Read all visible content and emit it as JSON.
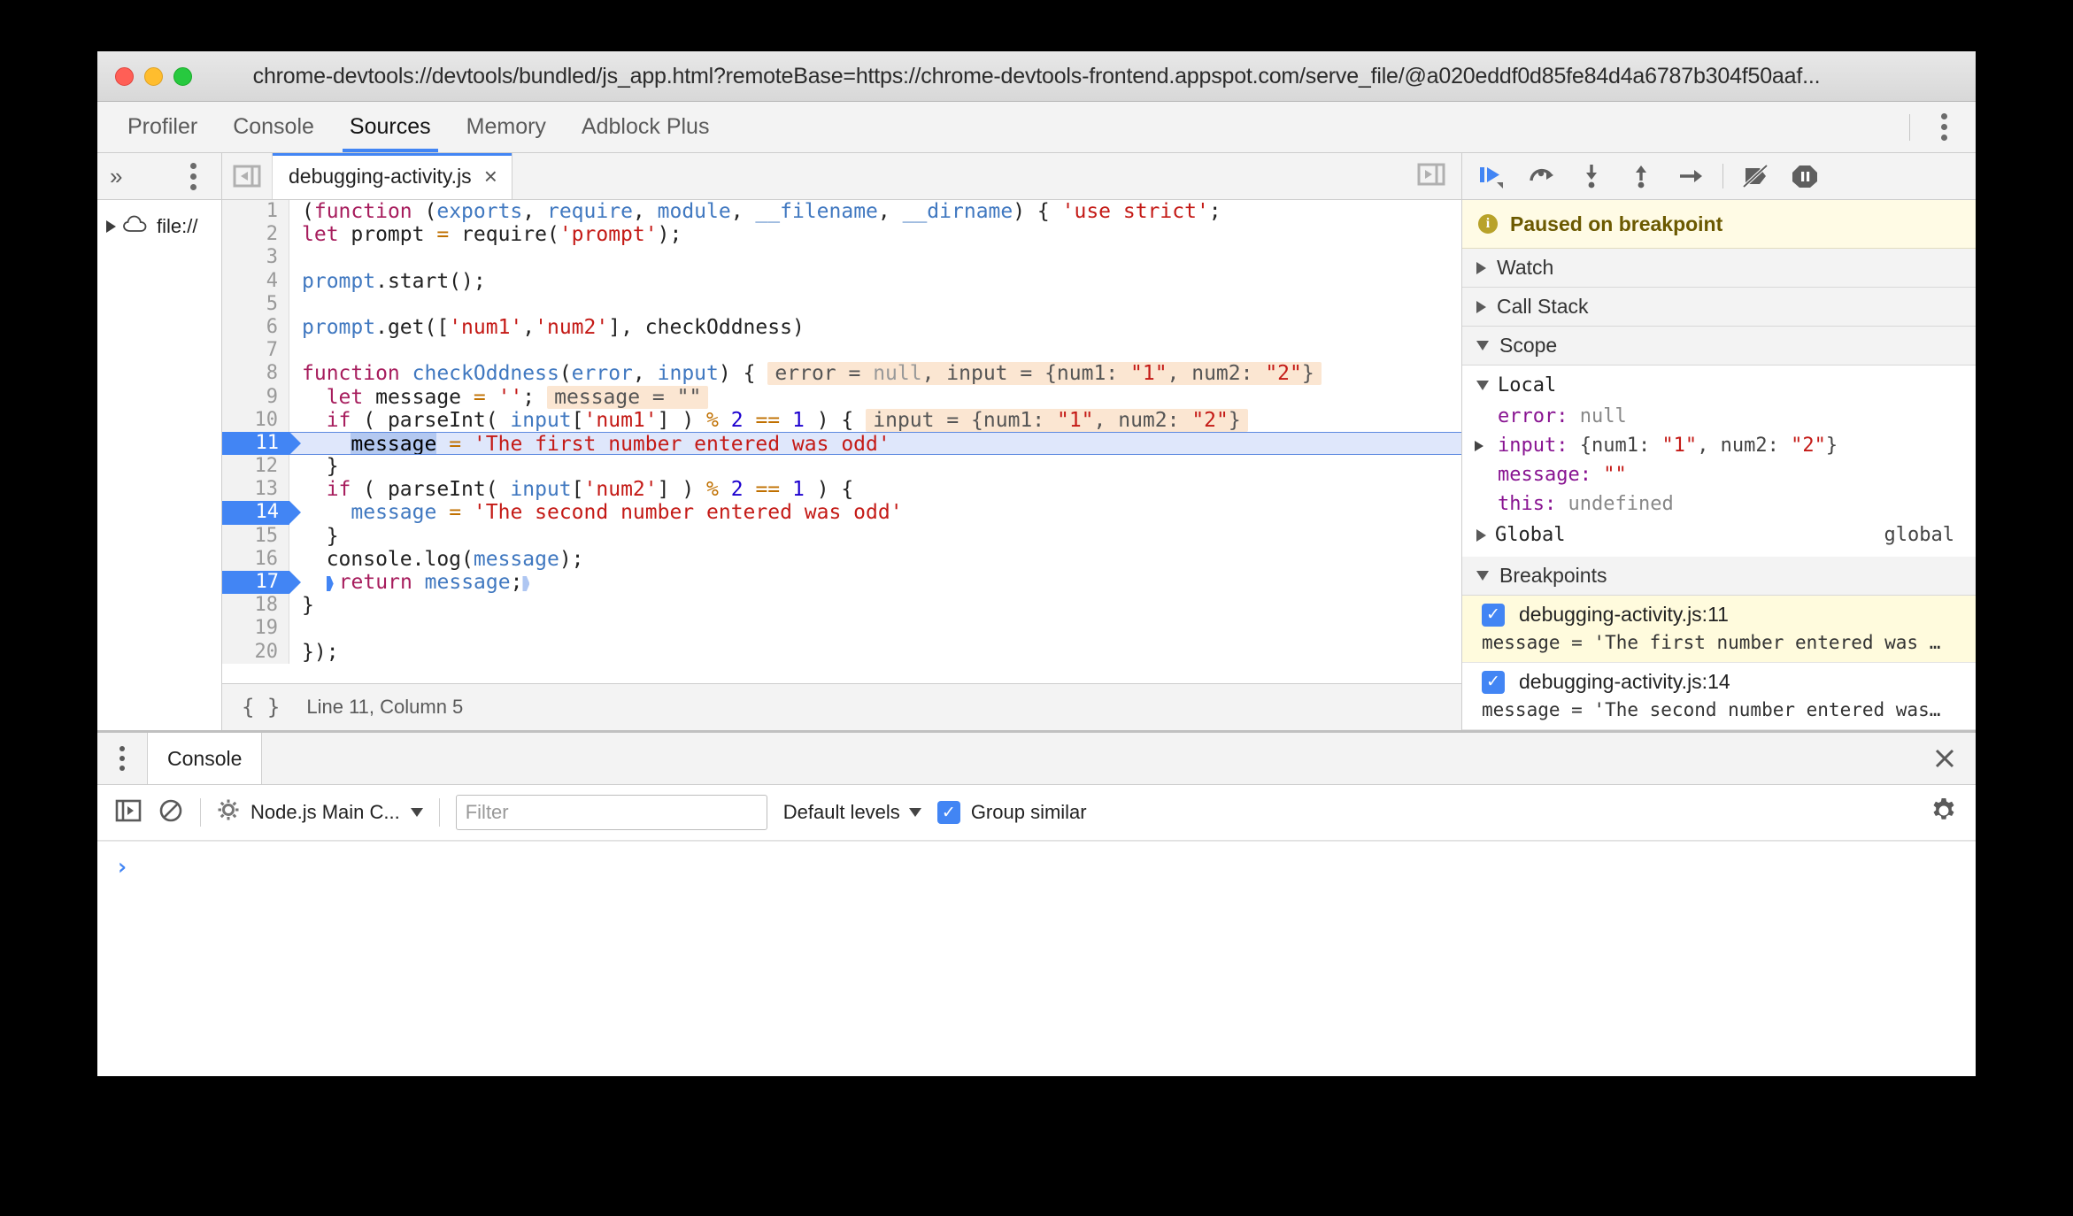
{
  "window": {
    "title": "chrome-devtools://devtools/bundled/js_app.html?remoteBase=https://chrome-devtools-frontend.appspot.com/serve_file/@a020eddf0d85fe84d4a6787b304f50aaf...",
    "traffic_colors": {
      "close": "#ff5f56",
      "minimize": "#ffbd2e",
      "zoom": "#27c93f"
    }
  },
  "devtools_tabs": [
    {
      "label": "Profiler",
      "active": false
    },
    {
      "label": "Console",
      "active": false
    },
    {
      "label": "Sources",
      "active": true
    },
    {
      "label": "Memory",
      "active": false
    },
    {
      "label": "Adblock Plus",
      "active": false
    }
  ],
  "navigator": {
    "more_label": "»",
    "tree": [
      {
        "label": "file://",
        "icon": "cloud-icon",
        "expanded": false
      }
    ]
  },
  "editor": {
    "tab": {
      "filename": "debugging-activity.js",
      "close_label": "×"
    },
    "status": {
      "braces": "{ }",
      "position": "Line 11, Column 5"
    },
    "lines": [
      {
        "n": "1",
        "state": "",
        "tokens": [
          {
            "t": "(",
            "c": "punc"
          },
          {
            "t": "function",
            "c": "kw"
          },
          {
            "t": " (",
            "c": "punc"
          },
          {
            "t": "exports",
            "c": "var"
          },
          {
            "t": ", ",
            "c": "punc"
          },
          {
            "t": "require",
            "c": "var"
          },
          {
            "t": ", ",
            "c": "punc"
          },
          {
            "t": "module",
            "c": "var"
          },
          {
            "t": ", ",
            "c": "punc"
          },
          {
            "t": "__filename",
            "c": "var"
          },
          {
            "t": ", ",
            "c": "punc"
          },
          {
            "t": "__dirname",
            "c": "var"
          },
          {
            "t": ") { ",
            "c": "punc"
          },
          {
            "t": "'use strict'",
            "c": "str"
          },
          {
            "t": ";",
            "c": "punc"
          }
        ]
      },
      {
        "n": "2",
        "state": "",
        "tokens": [
          {
            "t": "let",
            "c": "kw"
          },
          {
            "t": " prompt ",
            "c": "plain"
          },
          {
            "t": "=",
            "c": "op"
          },
          {
            "t": " require(",
            "c": "plain"
          },
          {
            "t": "'prompt'",
            "c": "str"
          },
          {
            "t": ");",
            "c": "punc"
          }
        ]
      },
      {
        "n": "3",
        "state": "",
        "tokens": []
      },
      {
        "n": "4",
        "state": "",
        "tokens": [
          {
            "t": "prompt",
            "c": "var"
          },
          {
            "t": ".start();",
            "c": "plain"
          }
        ]
      },
      {
        "n": "5",
        "state": "",
        "tokens": []
      },
      {
        "n": "6",
        "state": "",
        "tokens": [
          {
            "t": "prompt",
            "c": "var"
          },
          {
            "t": ".get([",
            "c": "plain"
          },
          {
            "t": "'num1'",
            "c": "str"
          },
          {
            "t": ",",
            "c": "punc"
          },
          {
            "t": "'num2'",
            "c": "str"
          },
          {
            "t": "], checkOddness)",
            "c": "plain"
          }
        ]
      },
      {
        "n": "7",
        "state": "",
        "tokens": []
      },
      {
        "n": "8",
        "state": "",
        "tokens": [
          {
            "t": "function",
            "c": "kw"
          },
          {
            "t": " ",
            "c": "plain"
          },
          {
            "t": "checkOddness",
            "c": "fname"
          },
          {
            "t": "(",
            "c": "punc"
          },
          {
            "t": "error",
            "c": "var"
          },
          {
            "t": ", ",
            "c": "punc"
          },
          {
            "t": "input",
            "c": "var"
          },
          {
            "t": ") {",
            "c": "punc"
          }
        ],
        "hint": [
          {
            "t": "error = ",
            "c": "hplain"
          },
          {
            "t": "null",
            "c": "hnull"
          },
          {
            "t": ", input = {num1: ",
            "c": "hplain"
          },
          {
            "t": "\"1\"",
            "c": "hstr"
          },
          {
            "t": ", num2: ",
            "c": "hplain"
          },
          {
            "t": "\"2\"",
            "c": "hstr"
          },
          {
            "t": "}",
            "c": "hplain"
          }
        ]
      },
      {
        "n": "9",
        "state": "",
        "tokens": [
          {
            "t": "  ",
            "c": "plain"
          },
          {
            "t": "let",
            "c": "kw"
          },
          {
            "t": " message ",
            "c": "plain"
          },
          {
            "t": "=",
            "c": "op"
          },
          {
            "t": " ",
            "c": "plain"
          },
          {
            "t": "''",
            "c": "str"
          },
          {
            "t": ";",
            "c": "punc"
          }
        ],
        "hint": [
          {
            "t": "message = \"\"",
            "c": "hplain"
          }
        ]
      },
      {
        "n": "10",
        "state": "",
        "tokens": [
          {
            "t": "  ",
            "c": "plain"
          },
          {
            "t": "if",
            "c": "kw"
          },
          {
            "t": " ( parseInt( ",
            "c": "plain"
          },
          {
            "t": "input",
            "c": "var"
          },
          {
            "t": "[",
            "c": "punc"
          },
          {
            "t": "'num1'",
            "c": "str"
          },
          {
            "t": "] ) ",
            "c": "punc"
          },
          {
            "t": "%",
            "c": "op"
          },
          {
            "t": " ",
            "c": "plain"
          },
          {
            "t": "2",
            "c": "num"
          },
          {
            "t": " ",
            "c": "plain"
          },
          {
            "t": "==",
            "c": "op"
          },
          {
            "t": " ",
            "c": "plain"
          },
          {
            "t": "1",
            "c": "num"
          },
          {
            "t": " ) {",
            "c": "punc"
          }
        ],
        "hint": [
          {
            "t": "input = {num1: ",
            "c": "hplain"
          },
          {
            "t": "\"1\"",
            "c": "hstr"
          },
          {
            "t": ", num2: ",
            "c": "hplain"
          },
          {
            "t": "\"2\"",
            "c": "hstr"
          },
          {
            "t": "}",
            "c": "hplain"
          }
        ]
      },
      {
        "n": "11",
        "state": "exec bp",
        "tokens": [
          {
            "t": "    ",
            "c": "plain"
          },
          {
            "t": "caret",
            "c": "caret"
          },
          {
            "t": "message",
            "c": "sel"
          },
          {
            "t": " ",
            "c": "plain"
          },
          {
            "t": "=",
            "c": "op"
          },
          {
            "t": " ",
            "c": "plain"
          },
          {
            "t": "'The first number entered was odd'",
            "c": "str"
          }
        ]
      },
      {
        "n": "12",
        "state": "",
        "tokens": [
          {
            "t": "  }",
            "c": "punc"
          }
        ]
      },
      {
        "n": "13",
        "state": "",
        "tokens": [
          {
            "t": "  ",
            "c": "plain"
          },
          {
            "t": "if",
            "c": "kw"
          },
          {
            "t": " ( parseInt( ",
            "c": "plain"
          },
          {
            "t": "input",
            "c": "var"
          },
          {
            "t": "[",
            "c": "punc"
          },
          {
            "t": "'num2'",
            "c": "str"
          },
          {
            "t": "] ) ",
            "c": "punc"
          },
          {
            "t": "%",
            "c": "op"
          },
          {
            "t": " ",
            "c": "plain"
          },
          {
            "t": "2",
            "c": "num"
          },
          {
            "t": " ",
            "c": "plain"
          },
          {
            "t": "==",
            "c": "op"
          },
          {
            "t": " ",
            "c": "plain"
          },
          {
            "t": "1",
            "c": "num"
          },
          {
            "t": " ) {",
            "c": "punc"
          }
        ]
      },
      {
        "n": "14",
        "state": "bp",
        "tokens": [
          {
            "t": "    ",
            "c": "plain"
          },
          {
            "t": "message",
            "c": "var"
          },
          {
            "t": " ",
            "c": "plain"
          },
          {
            "t": "=",
            "c": "op"
          },
          {
            "t": " ",
            "c": "plain"
          },
          {
            "t": "'The second number entered was odd'",
            "c": "str"
          }
        ]
      },
      {
        "n": "15",
        "state": "",
        "tokens": [
          {
            "t": "  }",
            "c": "punc"
          }
        ]
      },
      {
        "n": "16",
        "state": "",
        "tokens": [
          {
            "t": "  console.log(",
            "c": "plain"
          },
          {
            "t": "message",
            "c": "var"
          },
          {
            "t": ");",
            "c": "punc"
          }
        ]
      },
      {
        "n": "17",
        "state": "bp",
        "tokens": [
          {
            "t": "  ",
            "c": "plain"
          },
          {
            "t": "chev",
            "c": "chev"
          },
          {
            "t": "return",
            "c": "kw"
          },
          {
            "t": " ",
            "c": "plain"
          },
          {
            "t": "message",
            "c": "var"
          },
          {
            "t": ";",
            "c": "punc"
          },
          {
            "t": "chev-light",
            "c": "chev-light"
          }
        ]
      },
      {
        "n": "18",
        "state": "",
        "tokens": [
          {
            "t": "}",
            "c": "punc"
          }
        ]
      },
      {
        "n": "19",
        "state": "",
        "tokens": []
      },
      {
        "n": "20",
        "state": "",
        "tokens": [
          {
            "t": "});",
            "c": "punc"
          }
        ]
      }
    ]
  },
  "debugger": {
    "toolbar": [
      {
        "name": "resume-script-execution",
        "label": "Resume"
      },
      {
        "name": "step-over-next-function-call",
        "label": "Step over"
      },
      {
        "name": "step-into-next-function-call",
        "label": "Step into"
      },
      {
        "name": "step-out-of-current-function",
        "label": "Step out"
      },
      {
        "name": "step",
        "label": "Step"
      },
      {
        "name": "deactivate-breakpoints",
        "label": "Deactivate breakpoints"
      },
      {
        "name": "pause-on-exceptions",
        "label": "Pause on exceptions"
      }
    ],
    "paused_banner": "Paused on breakpoint",
    "sections": [
      {
        "label": "Watch",
        "expanded": false
      },
      {
        "label": "Call Stack",
        "expanded": false
      },
      {
        "label": "Scope",
        "expanded": true
      }
    ],
    "scope": {
      "local_label": "Local",
      "variables": [
        {
          "name": "error",
          "value": "null",
          "kind": "null",
          "expandable": false
        },
        {
          "name": "input",
          "value": "{num1: \"1\", num2: \"2\"}",
          "kind": "object",
          "expandable": true
        },
        {
          "name": "message",
          "value": "\"\"",
          "kind": "string",
          "expandable": false
        },
        {
          "name": "this",
          "value": "undefined",
          "kind": "null",
          "expandable": false
        }
      ],
      "global_label": "Global",
      "global_value": "global"
    },
    "breakpoints_label": "Breakpoints",
    "breakpoints": [
      {
        "location": "debugging-activity.js:11",
        "checked": true,
        "active": true,
        "snippet": "message = 'The first number entered was …"
      },
      {
        "location": "debugging-activity.js:14",
        "checked": true,
        "active": false,
        "snippet": "message = 'The second number entered was…"
      }
    ]
  },
  "console_drawer": {
    "tab_label": "Console",
    "close_label": "×",
    "context_label": "Node.js Main C...",
    "filter_placeholder": "Filter",
    "filter_value": "",
    "levels_label": "Default levels",
    "group_similar_label": "Group similar",
    "group_similar_checked": true,
    "prompt_symbol": "›"
  },
  "colors": {
    "accent_blue": "#4285f4",
    "paused_bg": "#fffbe5",
    "breakpoint_active_bg": "#fffbdd",
    "hint_bg": "#fbe6d2",
    "exec_line_bg": "#dfe7fb"
  }
}
